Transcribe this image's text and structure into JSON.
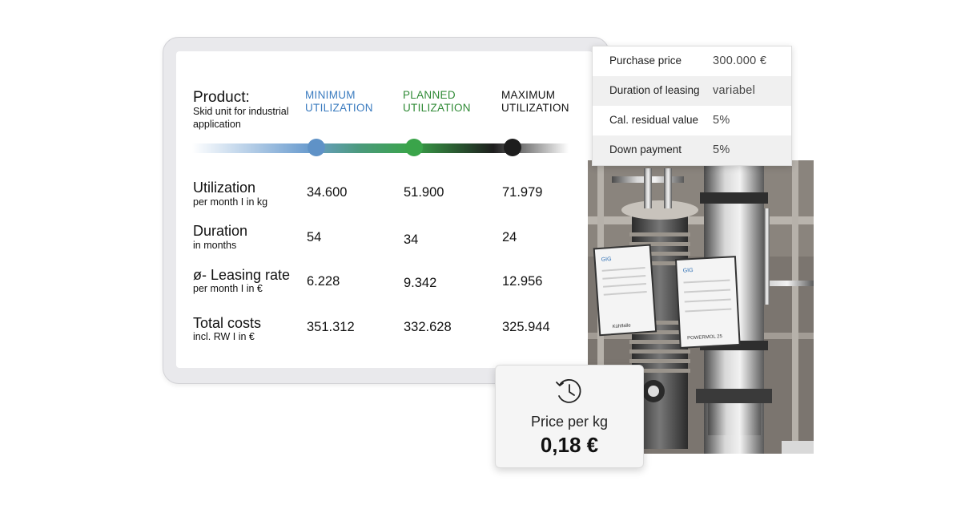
{
  "product": {
    "title": "Product:",
    "subtitle": "Skid unit for industrial application"
  },
  "columns": [
    {
      "line1": "MINIMUM",
      "line2": "UTILIZATION",
      "color": "#3a7bbf"
    },
    {
      "line1": "PLANNED",
      "line2": "UTILIZATION",
      "color": "#2f8a35"
    },
    {
      "line1": "MAXIMUM",
      "line2": "UTILIZATION",
      "color": "#111111"
    }
  ],
  "rows": [
    {
      "label": "Utilization",
      "sub": "per month I in kg",
      "values": [
        "34.600",
        "51.900",
        "71.979"
      ]
    },
    {
      "label": "Duration",
      "sub": "in months",
      "values": [
        "54",
        "34",
        "24"
      ]
    },
    {
      "label": "ø- Leasing rate",
      "sub": "per month I in €",
      "values": [
        "6.228",
        "9.342",
        "12.956"
      ]
    },
    {
      "label": "Total costs",
      "sub": "incl. RW I in €",
      "values": [
        "351.312",
        "332.628",
        "325.944"
      ]
    }
  ],
  "info": [
    {
      "label": "Purchase price",
      "value": "300.000 €"
    },
    {
      "label": "Duration of leasing",
      "value": "variabel"
    },
    {
      "label": "Cal. residual value",
      "value": "5%"
    },
    {
      "label": "Down payment",
      "value": "5%"
    }
  ],
  "price": {
    "label": "Price per kg",
    "value": "0,18 €",
    "icon": "clock-history-icon"
  },
  "machine": {
    "panel_left": "Kühlfalle",
    "panel_right": "POWERMOL 25",
    "brand": "GIG"
  }
}
